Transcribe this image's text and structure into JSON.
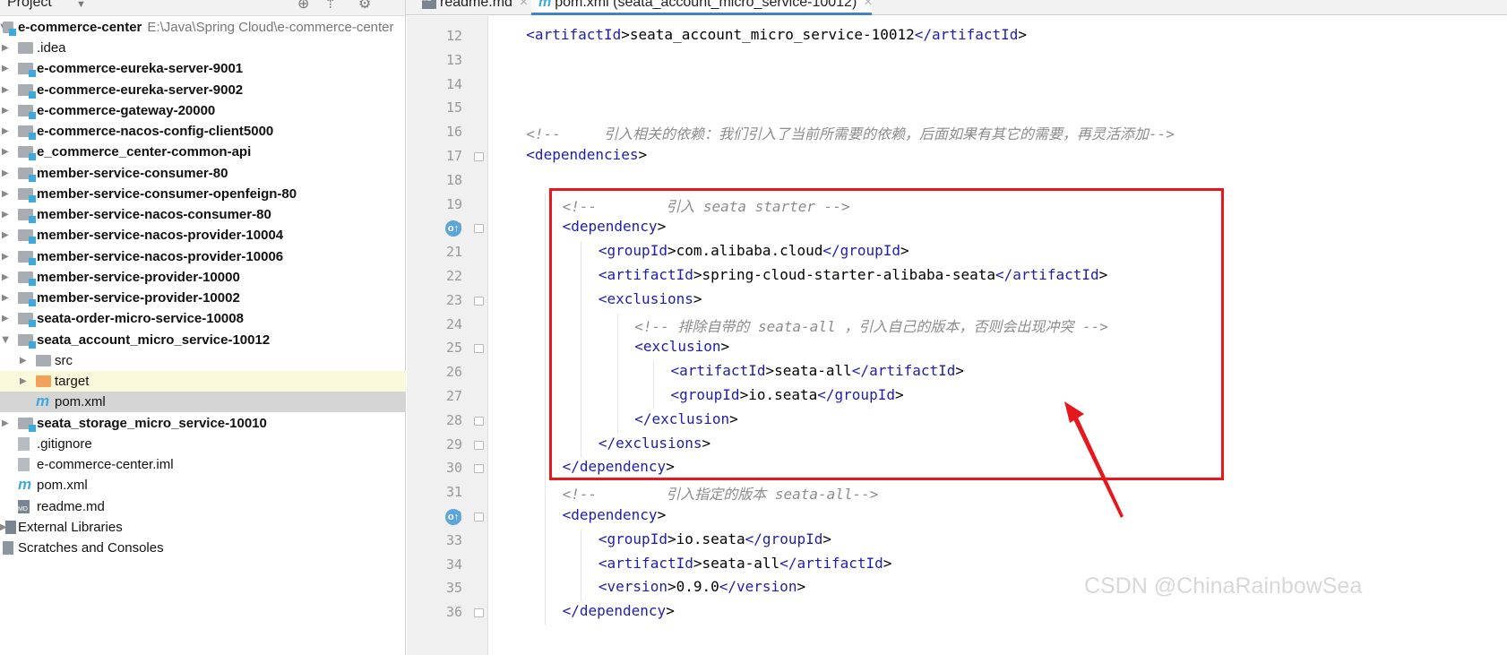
{
  "sidebar": {
    "title": "Project",
    "root": {
      "label": "e-commerce-center",
      "path": "E:\\Java\\Spring Cloud\\e-commerce-center"
    },
    "items": [
      {
        "label": ".idea",
        "bold": false,
        "type": "folder",
        "level": 1
      },
      {
        "label": "e-commerce-eureka-server-9001",
        "bold": true,
        "type": "module",
        "level": 1
      },
      {
        "label": "e-commerce-eureka-server-9002",
        "bold": true,
        "type": "module",
        "level": 1
      },
      {
        "label": "e-commerce-gateway-20000",
        "bold": true,
        "type": "module",
        "level": 1
      },
      {
        "label": "e-commerce-nacos-config-client5000",
        "bold": true,
        "type": "module",
        "level": 1
      },
      {
        "label": "e_commerce_center-common-api",
        "bold": true,
        "type": "module",
        "level": 1
      },
      {
        "label": "member-service-consumer-80",
        "bold": true,
        "type": "module",
        "level": 1
      },
      {
        "label": "member-service-consumer-openfeign-80",
        "bold": true,
        "type": "module",
        "level": 1
      },
      {
        "label": "member-service-nacos-consumer-80",
        "bold": true,
        "type": "module",
        "level": 1
      },
      {
        "label": "member-service-nacos-provider-10004",
        "bold": true,
        "type": "module",
        "level": 1
      },
      {
        "label": "member-service-nacos-provider-10006",
        "bold": true,
        "type": "module",
        "level": 1
      },
      {
        "label": "member-service-provider-10000",
        "bold": true,
        "type": "module",
        "level": 1
      },
      {
        "label": "member-service-provider-10002",
        "bold": true,
        "type": "module",
        "level": 1
      },
      {
        "label": "seata-order-micro-service-10008",
        "bold": true,
        "type": "module",
        "level": 1
      },
      {
        "label": "seata_account_micro_service-10012",
        "bold": true,
        "type": "module",
        "level": 1,
        "expanded": true
      },
      {
        "label": "src",
        "bold": false,
        "type": "folder",
        "level": 2
      },
      {
        "label": "target",
        "bold": false,
        "type": "folder-orange",
        "level": 2
      },
      {
        "label": "pom.xml",
        "bold": false,
        "type": "maven",
        "level": 2,
        "selected": true
      },
      {
        "label": "seata_storage_micro_service-10010",
        "bold": true,
        "type": "module",
        "level": 1
      },
      {
        "label": ".gitignore",
        "bold": false,
        "type": "file",
        "level": 1,
        "noarrow": true
      },
      {
        "label": "e-commerce-center.iml",
        "bold": false,
        "type": "file",
        "level": 1,
        "noarrow": true
      },
      {
        "label": "pom.xml",
        "bold": false,
        "type": "maven",
        "level": 1,
        "noarrow": true
      },
      {
        "label": "readme.md",
        "bold": false,
        "type": "md",
        "level": 1,
        "noarrow": true
      },
      {
        "label": "External Libraries",
        "bold": false,
        "type": "lib",
        "level": 0
      },
      {
        "label": "Scratches and Consoles",
        "bold": false,
        "type": "scratch",
        "level": 0,
        "noarrow": true
      }
    ]
  },
  "tabs": [
    {
      "label": "readme.md",
      "icon": "MD"
    },
    {
      "label": "pom.xml (seata_account_micro_service-10012)",
      "icon": "m",
      "active": true
    }
  ],
  "code": [
    {
      "n": 12,
      "i": 1,
      "t": "<artifactId>seata_account_micro_service-10012</artifactId>"
    },
    {
      "n": 13,
      "i": 0,
      "t": ""
    },
    {
      "n": 14,
      "i": 0,
      "t": ""
    },
    {
      "n": 15,
      "i": 0,
      "t": ""
    },
    {
      "n": 16,
      "i": 1,
      "t": "<!--     引入相关的依赖：我们引入了当前所需要的依赖，后面如果有其它的需要，再灵活添加-->"
    },
    {
      "n": 17,
      "i": 1,
      "t": "<dependencies>"
    },
    {
      "n": 18,
      "i": 0,
      "t": ""
    },
    {
      "n": 19,
      "i": 2,
      "t": "<!--        引入 seata starter -->"
    },
    {
      "n": 20,
      "i": 2,
      "t": "<dependency>",
      "gi": true
    },
    {
      "n": 21,
      "i": 3,
      "t": "<groupId>com.alibaba.cloud</groupId>"
    },
    {
      "n": 22,
      "i": 3,
      "t": "<artifactId>spring-cloud-starter-alibaba-seata</artifactId>"
    },
    {
      "n": 23,
      "i": 3,
      "t": "<exclusions>"
    },
    {
      "n": 24,
      "i": 4,
      "t": "<!-- 排除自带的 seata-all ，引入自己的版本，否则会出现冲突 -->"
    },
    {
      "n": 25,
      "i": 4,
      "t": "<exclusion>"
    },
    {
      "n": 26,
      "i": 5,
      "t": "<artifactId>seata-all</artifactId>"
    },
    {
      "n": 27,
      "i": 5,
      "t": "<groupId>io.seata</groupId>"
    },
    {
      "n": 28,
      "i": 4,
      "t": "</exclusion>"
    },
    {
      "n": 29,
      "i": 3,
      "t": "</exclusions>"
    },
    {
      "n": 30,
      "i": 2,
      "t": "</dependency>"
    },
    {
      "n": 31,
      "i": 2,
      "t": "<!--        引入指定的版本 seata-all-->"
    },
    {
      "n": 32,
      "i": 2,
      "t": "<dependency>",
      "gi": true
    },
    {
      "n": 33,
      "i": 3,
      "t": "<groupId>io.seata</groupId>"
    },
    {
      "n": 34,
      "i": 3,
      "t": "<artifactId>seata-all</artifactId>"
    },
    {
      "n": 35,
      "i": 3,
      "t": "<version>0.9.0</version>"
    },
    {
      "n": 36,
      "i": 2,
      "t": "</dependency>"
    }
  ],
  "watermark": "CSDN @ChinaRainbowSea",
  "colors": {
    "tag": "#1e1ea8",
    "comment": "#8c8c8c",
    "highlight": "#e8161d",
    "accent": "#3fa9db"
  }
}
